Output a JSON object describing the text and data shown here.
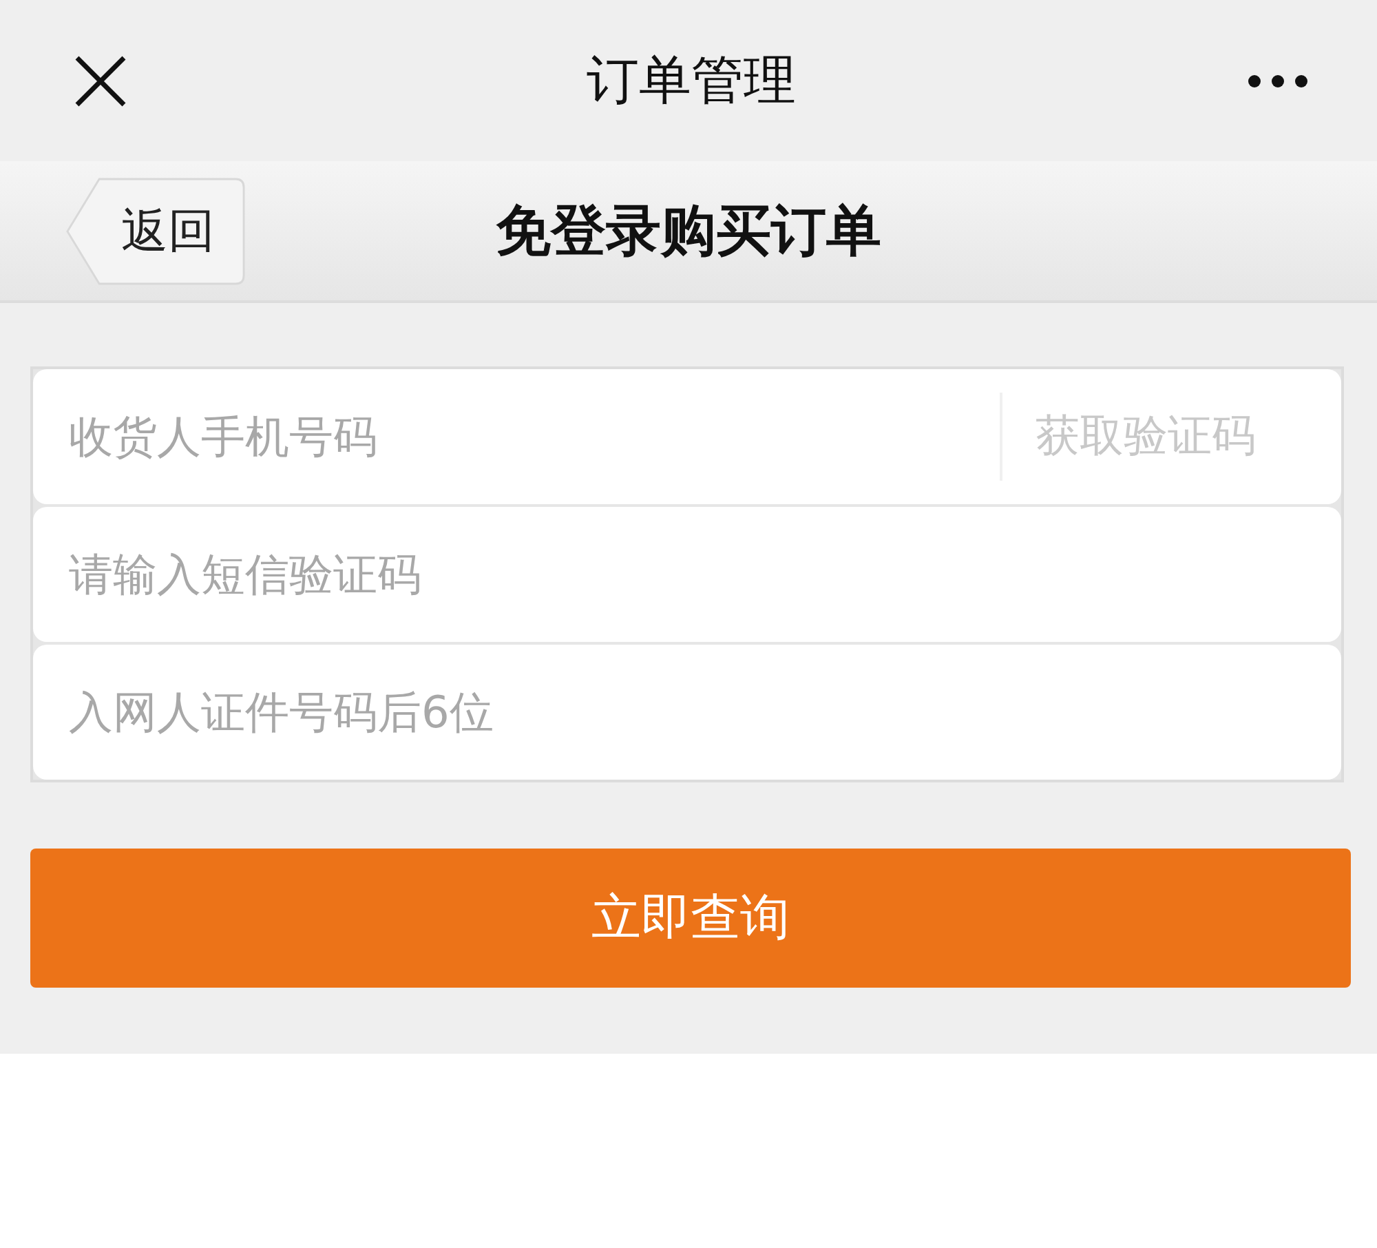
{
  "top_bar": {
    "title": "订单管理"
  },
  "header": {
    "back": "返回",
    "title": "免登录购买订单"
  },
  "fields": [
    {
      "placeholder": "收货人手机号码",
      "action": {
        "label": "获取验证码",
        "disabled": true
      }
    },
    {
      "placeholder": "请输入短信验证码"
    },
    {
      "placeholder": "入网人证件号码后6位"
    }
  ],
  "submit": {
    "label": "立即查询"
  }
}
